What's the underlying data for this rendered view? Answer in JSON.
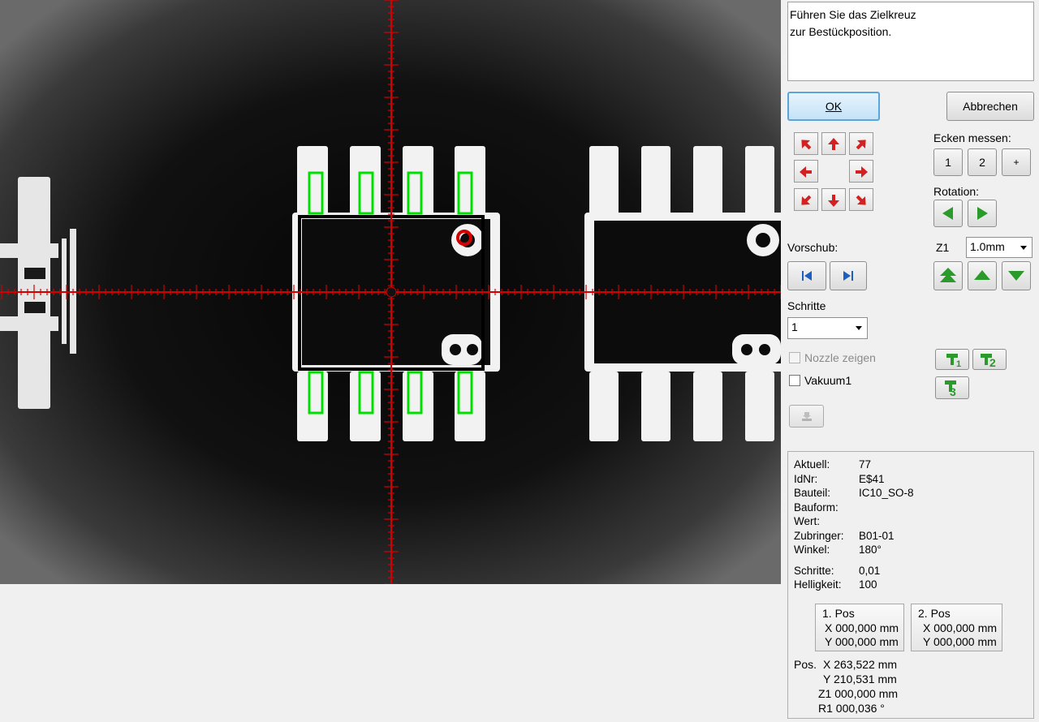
{
  "message": {
    "line1": "Führen Sie das Zielkreuz",
    "line2": "zur Bestückposition."
  },
  "buttons": {
    "ok": "OK",
    "cancel": "Abbrechen"
  },
  "corners": {
    "label": "Ecken messen:",
    "b1": "1",
    "b2": "2",
    "plus": "+"
  },
  "rotation": {
    "label": "Rotation:"
  },
  "feed": {
    "label": "Vorschub:"
  },
  "z": {
    "label": "Z1",
    "value": "1.0mm"
  },
  "steps": {
    "label": "Schritte",
    "value": "1"
  },
  "nozzle": {
    "label": "Nozzle zeigen",
    "checked": false
  },
  "vacuum": {
    "label": "Vakuum1",
    "checked": false
  },
  "tools": {
    "t1": "1",
    "t2": "2",
    "t3": "3"
  },
  "info": {
    "rows": [
      {
        "key": "Aktuell:",
        "value": "77"
      },
      {
        "key": "IdNr:",
        "value": "E$41"
      },
      {
        "key": "Bauteil:",
        "value": "IC10_SO-8"
      },
      {
        "key": "Bauform:",
        "value": ""
      },
      {
        "key": "Wert:",
        "value": ""
      },
      {
        "key": "Zubringer:",
        "value": "B01-01"
      },
      {
        "key": "Winkel:",
        "value": "180°"
      }
    ],
    "schritte_key": "Schritte:",
    "schritte_value": "0,01",
    "helligkeit_key": "Helligkeit:",
    "helligkeit_value": "100"
  },
  "pos1": {
    "title": "1. Pos",
    "x": "X 000,000 mm",
    "y": "Y 000,000 mm"
  },
  "pos2": {
    "title": "2. Pos",
    "x": "X 000,000 mm",
    "y": "Y 000,000 mm"
  },
  "position": {
    "label": "Pos.",
    "x": "X 263,522 mm",
    "y": "Y 210,531 mm",
    "z1": "Z1 000,000 mm",
    "r1": "R1 000,036 °"
  },
  "colors": {
    "crosshair": "#d40000",
    "pad_outline": "#00e000",
    "arrow": "#d42020",
    "green": "#2a9a2a"
  }
}
